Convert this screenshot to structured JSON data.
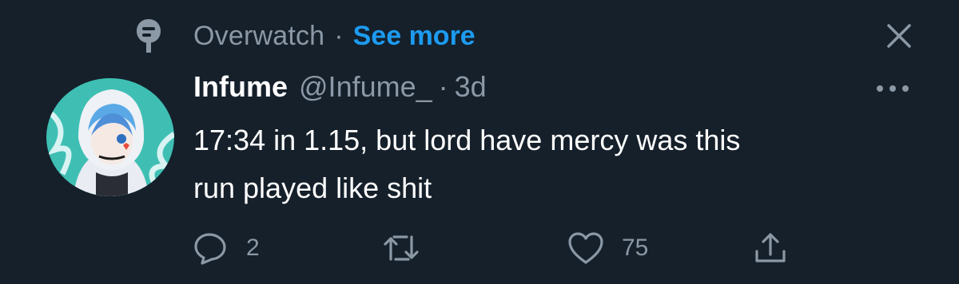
{
  "context": {
    "icon": "topic-icon",
    "topic": "Overwatch",
    "separator": "·",
    "see_more": "See more",
    "close_icon": "close-icon"
  },
  "tweet": {
    "display_name": "Infume",
    "handle": "@Infume_",
    "separator": "·",
    "time": "3d",
    "more_icon": "more-horizontal-icon",
    "text_line1": "17:34 in 1.15, but lord have mercy was this",
    "text_line2": "run played like shit",
    "avatar": "user-avatar"
  },
  "actions": {
    "reply_count": "2",
    "retweet_count": "",
    "like_count": "75",
    "share_count": ""
  },
  "colors": {
    "background": "#15202b",
    "muted": "#8b98a5",
    "accent": "#1d9bf0",
    "text": "#ffffff"
  }
}
